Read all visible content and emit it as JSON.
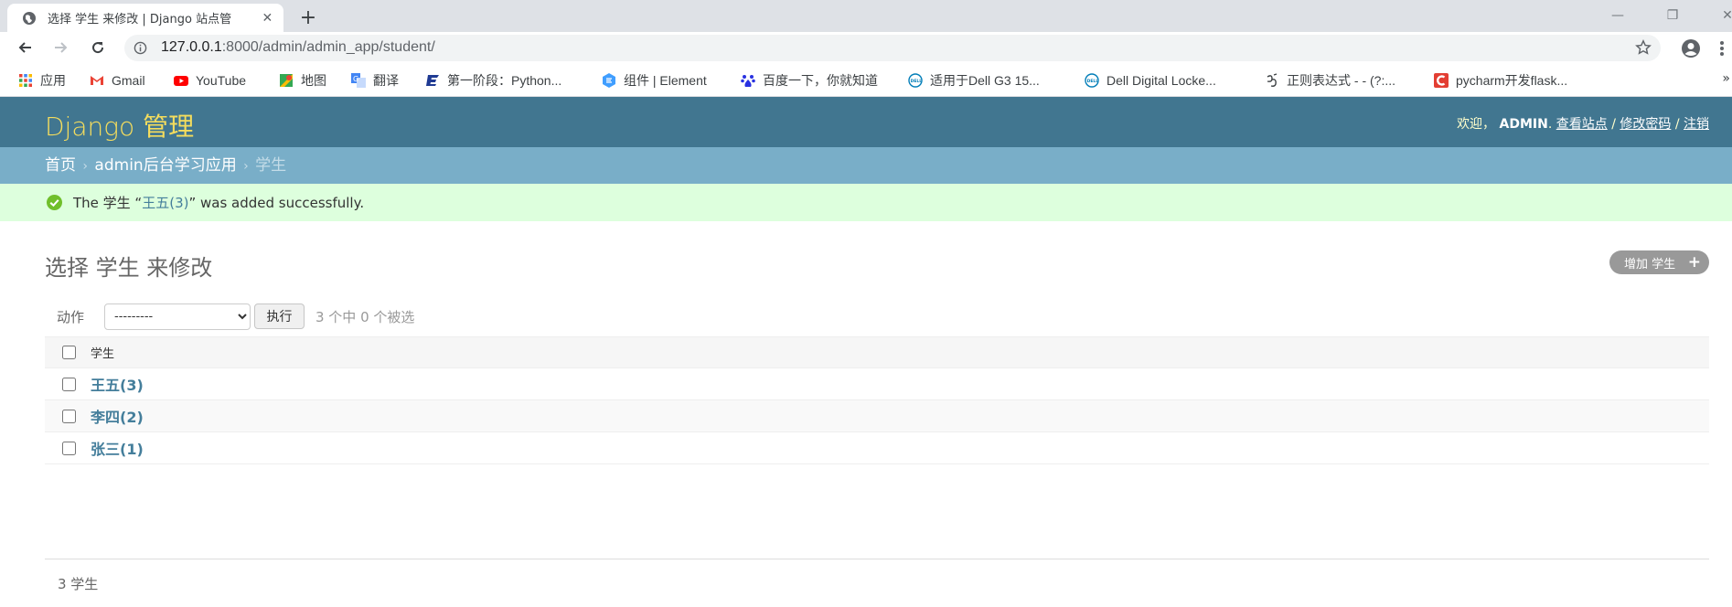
{
  "browser": {
    "tab_title": "选择 学生 来修改 | Django 站点管",
    "url_host": "127.0.0.1",
    "url_rest": ":8000/admin/admin_app/student/",
    "bookmarks": [
      {
        "label": "应用",
        "icon": "apps-grid-icon"
      },
      {
        "label": "Gmail",
        "icon": "gmail-icon"
      },
      {
        "label": "YouTube",
        "icon": "youtube-icon"
      },
      {
        "label": "地图",
        "icon": "maps-icon"
      },
      {
        "label": "翻译",
        "icon": "translate-icon"
      },
      {
        "label": "第一阶段：Python...",
        "icon": "bookmark-e-icon"
      },
      {
        "label": "组件 | Element",
        "icon": "element-icon"
      },
      {
        "label": "百度一下，你就知道",
        "icon": "baidu-icon"
      },
      {
        "label": "适用于Dell G3 15...",
        "icon": "dell-icon"
      },
      {
        "label": "Dell Digital Locke...",
        "icon": "dell-icon"
      },
      {
        "label": "正则表达式 -  - (?:...",
        "icon": "regex-icon"
      },
      {
        "label": "pycharm开发flask...",
        "icon": "csdn-icon"
      }
    ],
    "bookmarks_more": "»"
  },
  "header": {
    "branding": "Django 管理",
    "welcome": "欢迎，",
    "username": "ADMIN",
    "view_site": "查看站点",
    "change_password": "修改密码",
    "logout": "注销",
    "slash": "/",
    "dot": "."
  },
  "breadcrumbs": {
    "home": "首页",
    "app": "admin后台学习应用",
    "current": "学生",
    "sep": "›"
  },
  "message": {
    "prefix": "The 学生 “",
    "link": "王五(3)",
    "suffix": "” was added successfully."
  },
  "content": {
    "title": "选择 学生 来修改",
    "add_button": "增加 学生",
    "add_plus": "+"
  },
  "actions": {
    "label": "动作",
    "selected_option": "---------",
    "go_button": "执行",
    "counter": "3 个中 0 个被选"
  },
  "table": {
    "header": "学生",
    "rows": [
      "王五(3)",
      "李四(2)",
      "张三(1)"
    ]
  },
  "paginator": "3 学生",
  "colors": {
    "header_bg": "#417690",
    "branding": "#f5dd5d",
    "breadcrumbs_bg": "#79aec8",
    "success_bg": "#ddffdd",
    "link": "#447e9b"
  }
}
